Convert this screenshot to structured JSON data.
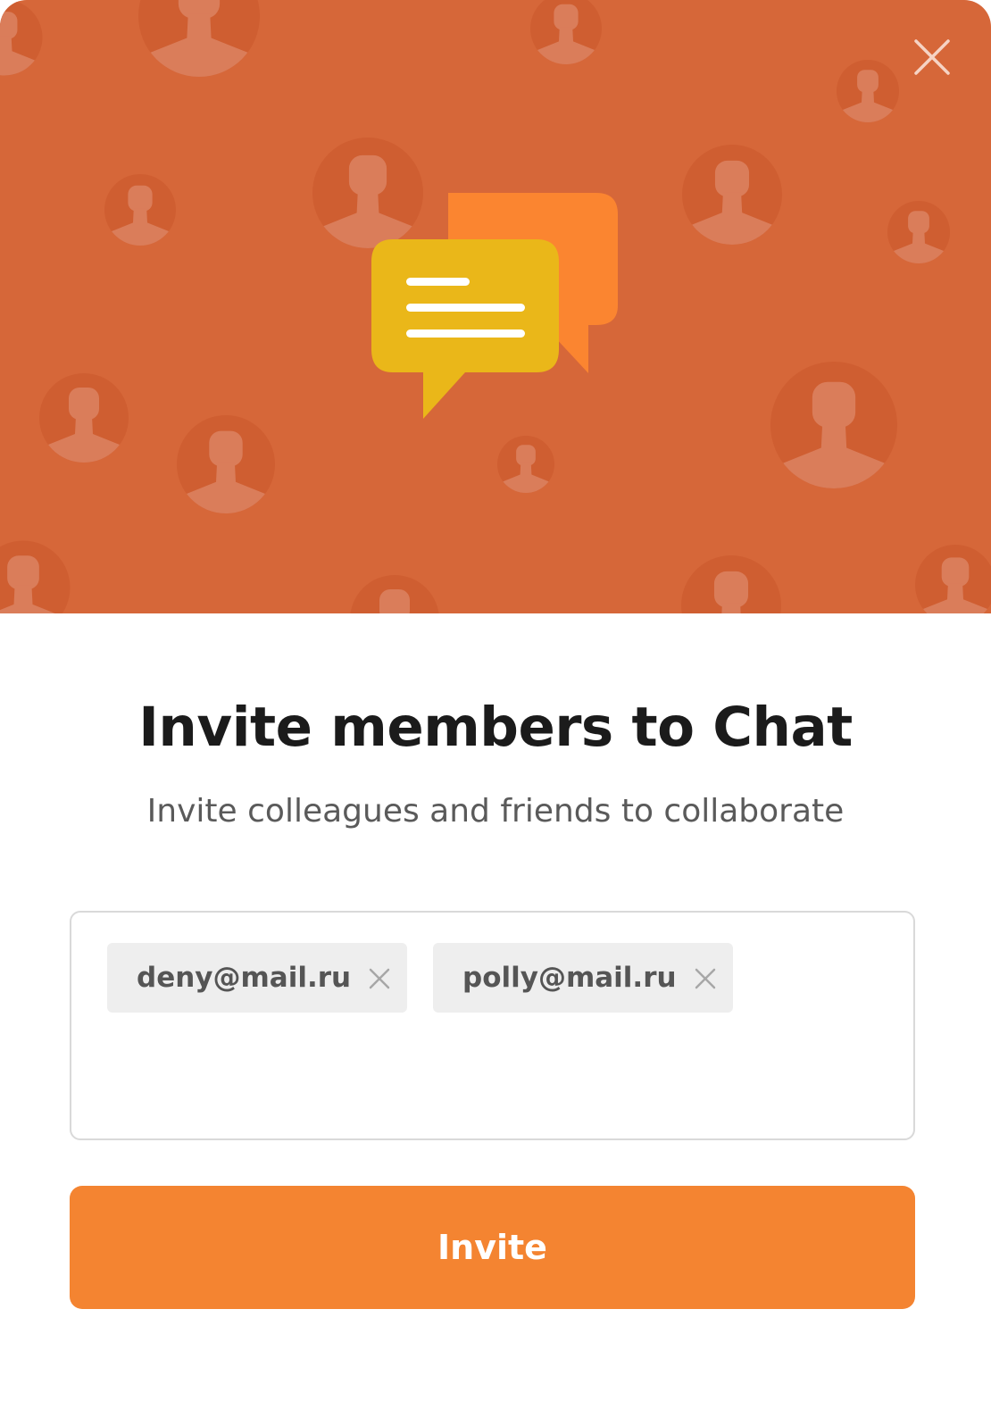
{
  "dialog": {
    "title": "Invite members to Chat",
    "subtitle": "Invite colleagues and friends to collaborate",
    "close_icon": "close-icon",
    "illustration_icon": "chat-bubbles-icon"
  },
  "recipients": {
    "chips": [
      {
        "label": "deny@mail.ru",
        "remove_icon": "remove-icon"
      },
      {
        "label": "polly@mail.ru",
        "remove_icon": "remove-icon"
      }
    ]
  },
  "actions": {
    "invite_label": "Invite"
  },
  "colors": {
    "hero_background": "#d66739",
    "avatar_circle": "#cf5e31",
    "avatar_figure": "#da7d5a",
    "bubble_back": "#fb8530",
    "bubble_front": "#eab719",
    "accent": "#f48431",
    "chip_background": "#eeeeee",
    "title_text": "#1b1b1b",
    "subtitle_text": "#5a5a5a"
  }
}
